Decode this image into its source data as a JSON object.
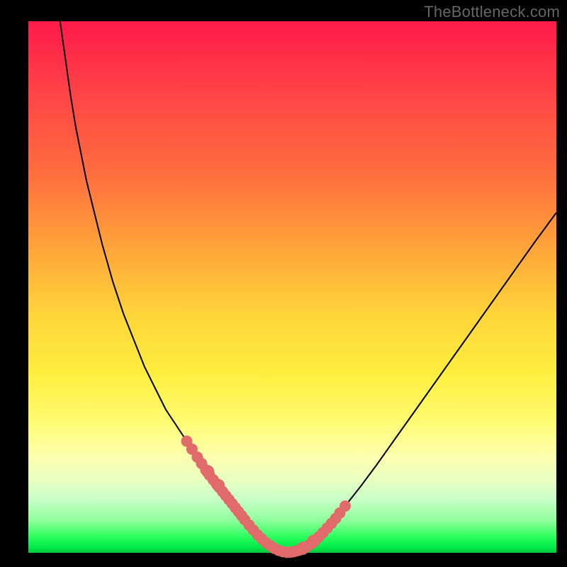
{
  "watermark": {
    "text": "TheBottleneck.com"
  },
  "chart_data": {
    "type": "line",
    "title": "",
    "xlabel": "",
    "ylabel": "",
    "xlim": [
      0,
      100
    ],
    "ylim": [
      0,
      100
    ],
    "series": [
      {
        "name": "curve",
        "x": [
          6,
          7,
          8,
          9,
          10,
          11,
          12,
          14,
          16,
          18,
          20,
          22,
          24,
          26,
          28,
          30,
          32,
          34,
          36,
          38,
          40,
          41,
          42,
          43,
          44,
          45,
          46,
          47,
          48,
          49,
          50,
          52,
          54,
          56,
          58,
          60,
          63,
          66,
          69,
          72,
          76,
          80,
          84,
          88,
          92,
          96,
          100
        ],
        "y": [
          100,
          93,
          86,
          80,
          75,
          70,
          66,
          58,
          51,
          45,
          40,
          35,
          31,
          27,
          24,
          21,
          18,
          15,
          12.5,
          10,
          7.5,
          6.2,
          5,
          3.8,
          2.8,
          1.9,
          1.2,
          0.6,
          0.25,
          0.1,
          0.15,
          0.7,
          2.0,
          4.0,
          6.2,
          8.8,
          12.6,
          16.6,
          20.8,
          25.0,
          30.6,
          36.2,
          41.8,
          47.4,
          53.0,
          58.6,
          64.0
        ]
      }
    ],
    "dot_clusters": [
      {
        "name": "left-cluster",
        "x_range": [
          30,
          41
        ],
        "y_range": [
          5,
          22
        ]
      },
      {
        "name": "right-cluster",
        "x_range": [
          49,
          58
        ],
        "y_range": [
          0.5,
          8
        ]
      },
      {
        "name": "right-high-dot",
        "x": 60,
        "y": 9
      }
    ],
    "dot_color": "#e16a6a",
    "curve_color": "#000000"
  }
}
